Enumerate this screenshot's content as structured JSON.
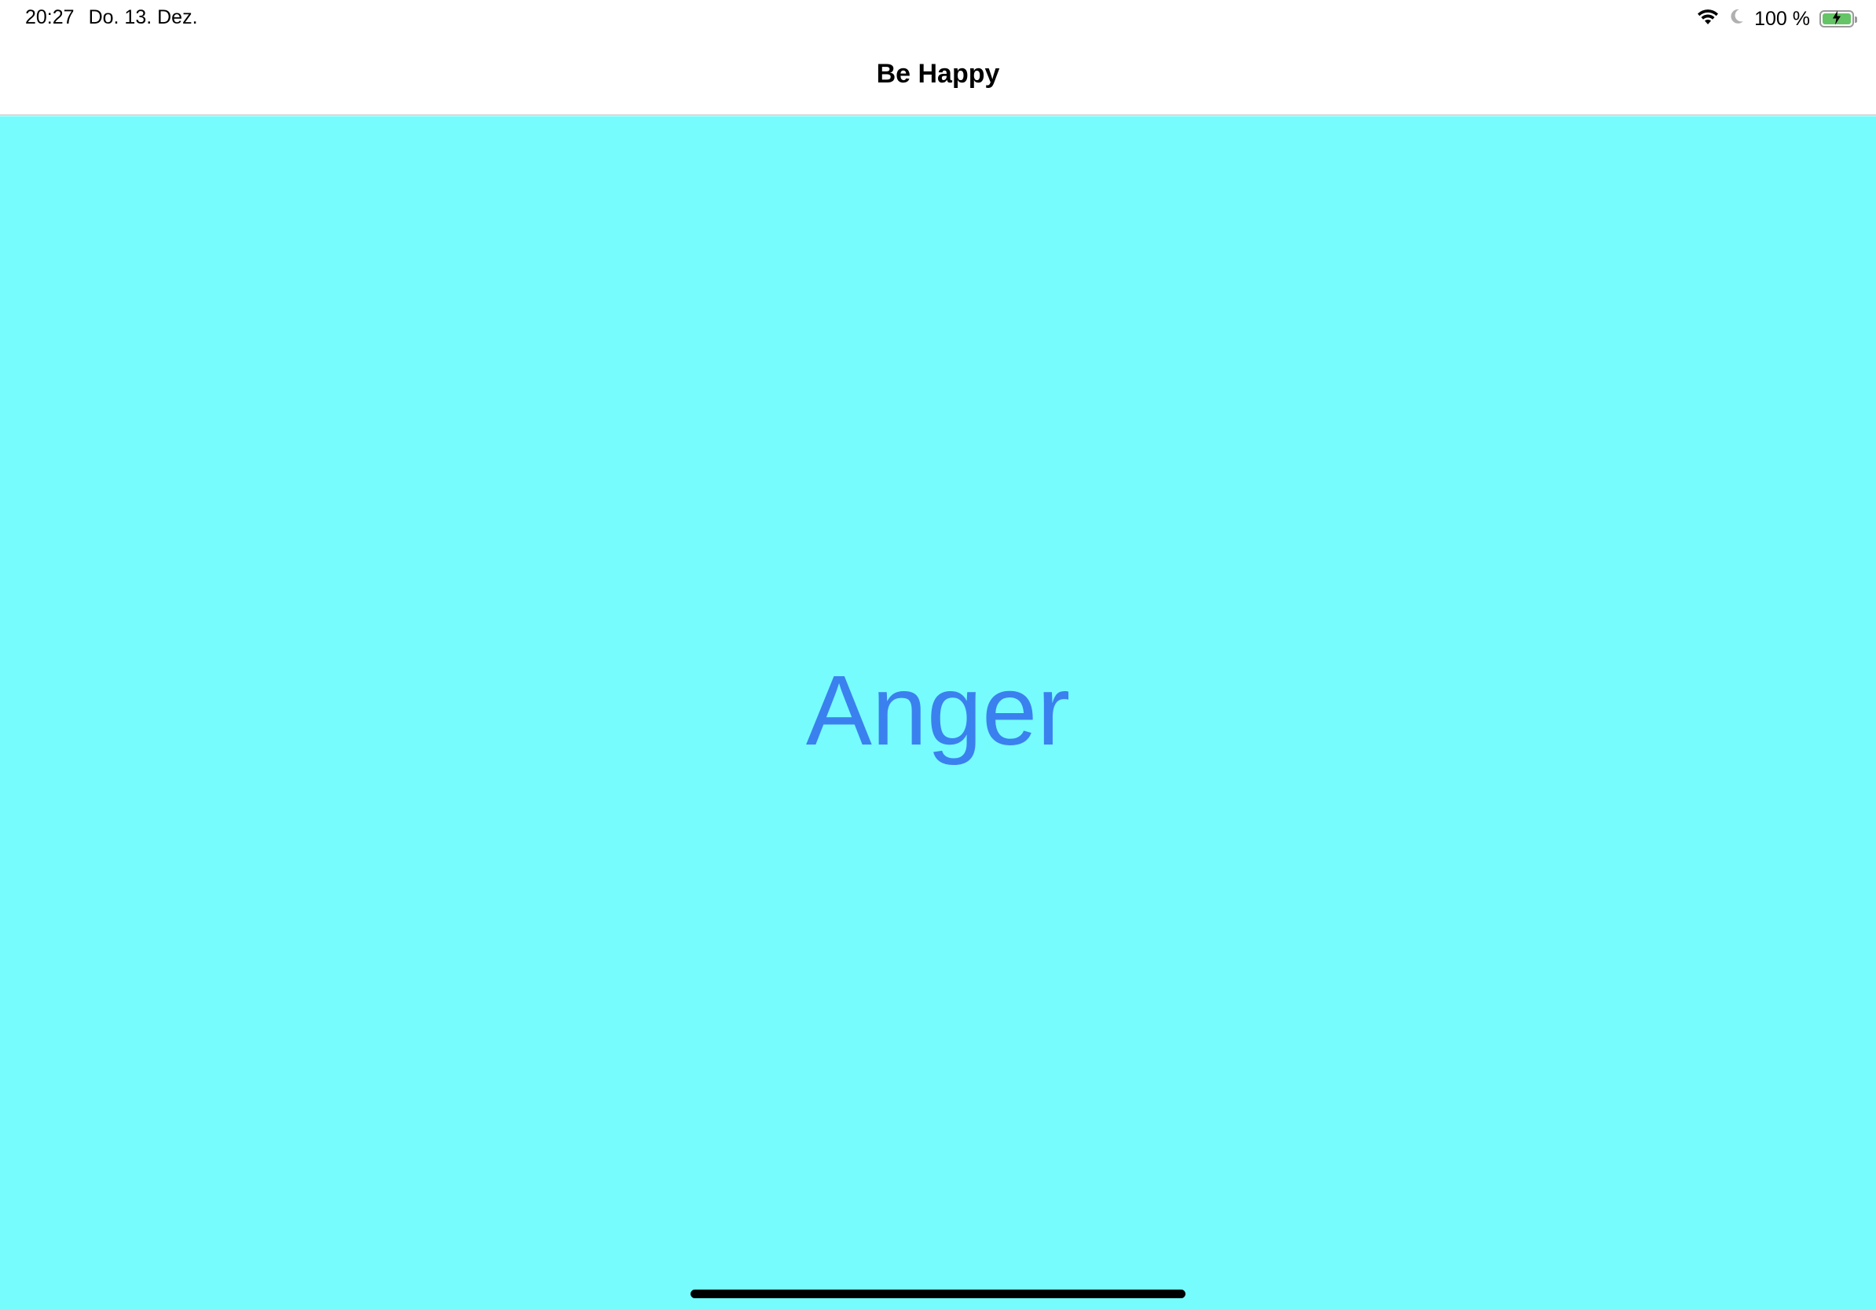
{
  "status_bar": {
    "time": "20:27",
    "date": "Do. 13. Dez.",
    "battery_text": "100 %",
    "icons": [
      "wifi-icon",
      "moon-icon",
      "battery-icon"
    ]
  },
  "nav_bar": {
    "title": "Be Happy"
  },
  "main": {
    "label": "Anger",
    "background_color": "#76fcfd",
    "label_color": "#3b80ef"
  }
}
